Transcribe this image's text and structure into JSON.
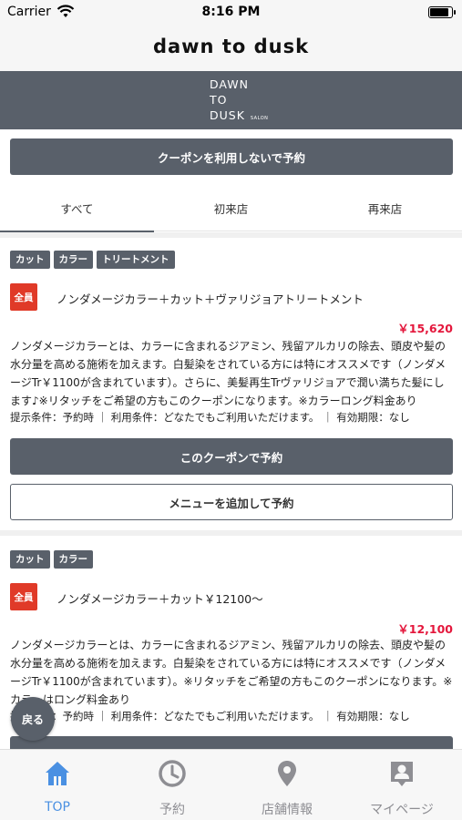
{
  "status_bar": {
    "carrier": "Carrier",
    "time": "8:16 PM"
  },
  "nav": {
    "title": "dawn to dusk"
  },
  "logo": {
    "line1": "DAWN",
    "line2": "TO",
    "line3": "DUSK",
    "sub": "SALON"
  },
  "no_coupon_button": "クーポンを利用しないで予約",
  "tabs": [
    {
      "label": "すべて",
      "active": true
    },
    {
      "label": "初来店",
      "active": false
    },
    {
      "label": "再来店",
      "active": false
    }
  ],
  "coupons": [
    {
      "tags": [
        "カット",
        "カラー",
        "トリートメント"
      ],
      "badge": "全員",
      "title": "ノンダメージカラー＋カット＋ヴァリジョアトリートメント",
      "price": "￥15,620",
      "description": "ノンダメージカラーとは、カラーに含まれるジアミン、残留アルカリの除去、頭皮や髪の水分量を高める施術を加えます。白髪染をされている方には特にオススメです（ノンダメージTr￥1100が含まれています）。さらに、美髪再生Trヴァリジョアで潤い満ちた髪にします♪※リタッチをご希望の方もこのクーポンになります。※カラーロング料金あり",
      "conditions": "提示条件：予約時 ｜ 利用条件：どなたでもご利用いただけます。 ｜ 有効期限：なし",
      "book_button": "このクーポンで予約",
      "add_menu_button": "メニューを追加して予約"
    },
    {
      "tags": [
        "カット",
        "カラー"
      ],
      "badge": "全員",
      "title": "ノンダメージカラー＋カット￥12100〜",
      "price": "￥12,100",
      "description": "ノンダメージカラーとは、カラーに含まれるジアミン、残留アルカリの除去、頭皮や髪の水分量を高める施術を加えます。白髪染をされている方には特にオススメです（ノンダメージTr￥1100が含まれています）。※リタッチをご希望の方もこのクーポンになります。※カラーはロング料金あり",
      "conditions": "提示条件：予約時 ｜ 利用条件：どなたでもご利用いただけます。 ｜ 有効期限：なし"
    }
  ],
  "back_button": "戻る",
  "tabbar": [
    {
      "label": "TOP",
      "icon": "home-icon",
      "active": true
    },
    {
      "label": "予約",
      "icon": "clock-icon",
      "active": false
    },
    {
      "label": "店舗情報",
      "icon": "map-pin-icon",
      "active": false
    },
    {
      "label": "マイページ",
      "icon": "user-badge-icon",
      "active": false
    }
  ],
  "colors": {
    "primary": "#59606a",
    "price": "#e4173c",
    "badge": "#e03a28",
    "tab_active": "#4a90e2"
  }
}
